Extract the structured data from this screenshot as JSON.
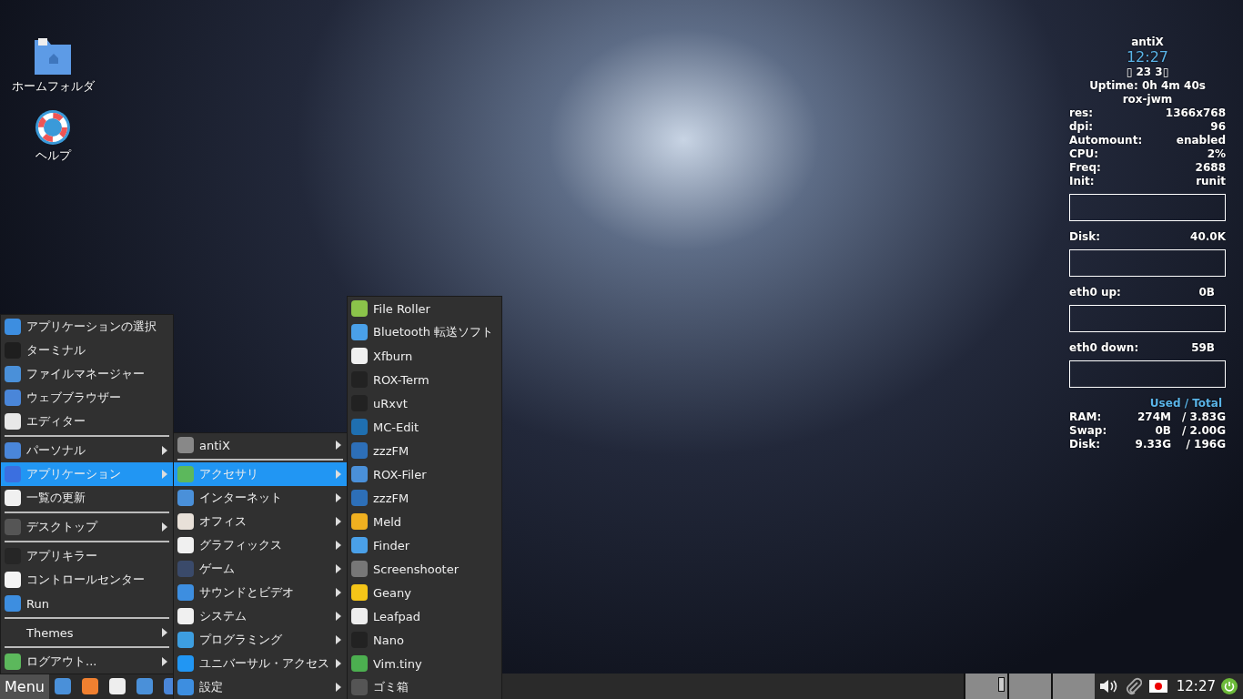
{
  "desktop_icons": [
    {
      "label": "ホームフォルダ"
    },
    {
      "label": "ヘルプ"
    }
  ],
  "conky": {
    "title": "antiX",
    "clock": "12:27",
    "date": "▯ 23  3▯",
    "uptime": "Uptime: 0h 4m 40s",
    "wm": "rox-jwm",
    "stats": [
      {
        "label": "res:",
        "value": "1366x768"
      },
      {
        "label": "dpi:",
        "value": "96"
      },
      {
        "label": "Automount:",
        "value": "enabled"
      },
      {
        "label": "CPU:",
        "value": "2%"
      },
      {
        "label": "Freq:",
        "value": "2688"
      },
      {
        "label": "Init:",
        "value": "runit"
      }
    ],
    "monitors": [
      {
        "label": "Disk:",
        "value": "40.0K"
      },
      {
        "label": "eth0 up:",
        "value": "0B"
      },
      {
        "label": "eth0 down:",
        "value": "59B"
      }
    ],
    "memory_heading": "Used / Total",
    "memory": [
      {
        "label": "RAM:",
        "used": "274M",
        "total": "/ 3.83G"
      },
      {
        "label": "Swap:",
        "used": "0B",
        "total": "/ 2.00G"
      },
      {
        "label": "Disk:",
        "used": "9.33G",
        "total": "/ 196G"
      }
    ]
  },
  "main_menu": {
    "items": [
      {
        "kind": "item",
        "label": "アプリケーションの選択",
        "submenu": false,
        "selected": false
      },
      {
        "kind": "item",
        "label": "ターミナル",
        "submenu": false,
        "selected": false
      },
      {
        "kind": "item",
        "label": "ファイルマネージャー",
        "submenu": false,
        "selected": false
      },
      {
        "kind": "item",
        "label": "ウェブブラウザー",
        "submenu": false,
        "selected": false
      },
      {
        "kind": "item",
        "label": "エディター",
        "submenu": false,
        "selected": false
      },
      {
        "kind": "separator"
      },
      {
        "kind": "item",
        "label": "パーソナル",
        "submenu": true,
        "selected": false
      },
      {
        "kind": "item",
        "label": "アプリケーション",
        "submenu": true,
        "selected": true
      },
      {
        "kind": "item",
        "label": "一覧の更新",
        "submenu": false,
        "selected": false
      },
      {
        "kind": "separator"
      },
      {
        "kind": "item",
        "label": "デスクトップ",
        "submenu": true,
        "selected": false
      },
      {
        "kind": "separator"
      },
      {
        "kind": "item",
        "label": "アプリキラー",
        "submenu": false,
        "selected": false
      },
      {
        "kind": "item",
        "label": "コントロールセンター",
        "submenu": false,
        "selected": false
      },
      {
        "kind": "item",
        "label": "Run",
        "submenu": false,
        "selected": false
      },
      {
        "kind": "separator"
      },
      {
        "kind": "item",
        "label": "Themes",
        "submenu": true,
        "selected": false
      },
      {
        "kind": "separator"
      },
      {
        "kind": "item",
        "label": "ログアウト...",
        "submenu": true,
        "selected": false
      }
    ]
  },
  "applications_menu": {
    "items": [
      {
        "kind": "item",
        "label": "antiX",
        "submenu": true,
        "selected": false
      },
      {
        "kind": "separator"
      },
      {
        "kind": "item",
        "label": "アクセサリ",
        "submenu": true,
        "selected": true
      },
      {
        "kind": "item",
        "label": "インターネット",
        "submenu": true,
        "selected": false
      },
      {
        "kind": "item",
        "label": "オフィス",
        "submenu": true,
        "selected": false
      },
      {
        "kind": "item",
        "label": "グラフィックス",
        "submenu": true,
        "selected": false
      },
      {
        "kind": "item",
        "label": "ゲーム",
        "submenu": true,
        "selected": false
      },
      {
        "kind": "item",
        "label": "サウンドとビデオ",
        "submenu": true,
        "selected": false
      },
      {
        "kind": "item",
        "label": "システム",
        "submenu": true,
        "selected": false
      },
      {
        "kind": "item",
        "label": "プログラミング",
        "submenu": true,
        "selected": false
      },
      {
        "kind": "item",
        "label": "ユニバーサル・アクセス",
        "submenu": true,
        "selected": false
      },
      {
        "kind": "item",
        "label": "設定",
        "submenu": true,
        "selected": false
      }
    ]
  },
  "accessories_menu": {
    "items": [
      {
        "kind": "item",
        "label": "File Roller",
        "submenu": false,
        "selected": false
      },
      {
        "kind": "item",
        "label": "Bluetooth 転送ソフト",
        "submenu": false,
        "selected": false
      },
      {
        "kind": "item",
        "label": "Xfburn",
        "submenu": false,
        "selected": false
      },
      {
        "kind": "item",
        "label": "ROX-Term",
        "submenu": false,
        "selected": false
      },
      {
        "kind": "item",
        "label": "uRxvt",
        "submenu": false,
        "selected": false
      },
      {
        "kind": "item",
        "label": "MC-Edit",
        "submenu": false,
        "selected": false
      },
      {
        "kind": "item",
        "label": "zzzFM",
        "submenu": false,
        "selected": false
      },
      {
        "kind": "item",
        "label": "ROX-Filer",
        "submenu": false,
        "selected": false
      },
      {
        "kind": "item",
        "label": "zzzFM",
        "submenu": false,
        "selected": false
      },
      {
        "kind": "item",
        "label": "Meld",
        "submenu": false,
        "selected": false
      },
      {
        "kind": "item",
        "label": "Finder",
        "submenu": false,
        "selected": false
      },
      {
        "kind": "item",
        "label": "Screenshooter",
        "submenu": false,
        "selected": false
      },
      {
        "kind": "item",
        "label": "Geany",
        "submenu": false,
        "selected": false
      },
      {
        "kind": "item",
        "label": "Leafpad",
        "submenu": false,
        "selected": false
      },
      {
        "kind": "item",
        "label": "Nano",
        "submenu": false,
        "selected": false
      },
      {
        "kind": "item",
        "label": "Vim.tiny",
        "submenu": false,
        "selected": false
      },
      {
        "kind": "item",
        "label": "ゴミ箱",
        "submenu": false,
        "selected": false
      }
    ]
  },
  "taskbar": {
    "menu_button": "Menu",
    "clock": "12:27"
  }
}
